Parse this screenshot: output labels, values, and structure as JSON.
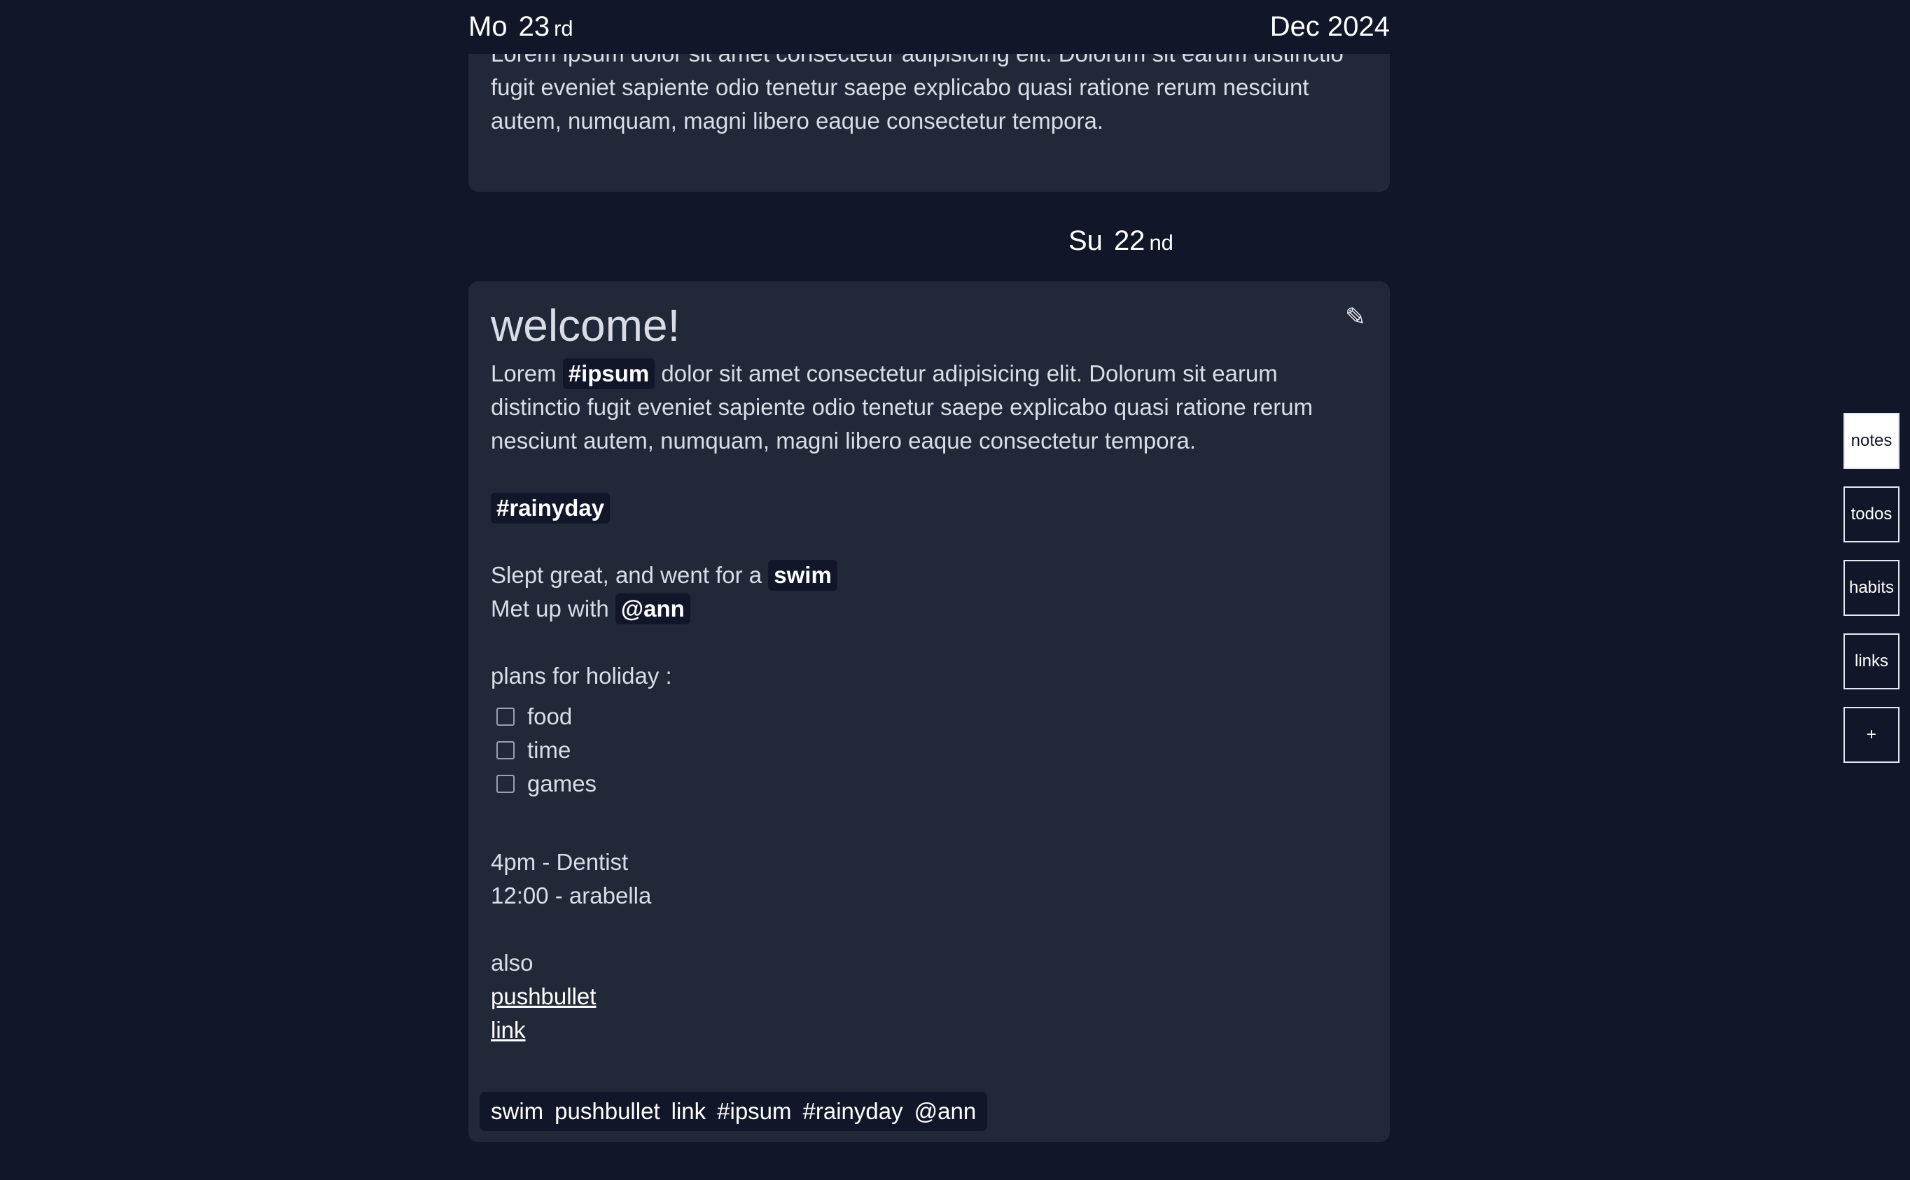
{
  "header": {
    "dow": "Mo",
    "num": "23",
    "suffix": "rd",
    "monthyear": "Dec 2024"
  },
  "prev_card": {
    "text": "Lorem ipsum dolor sit amet consectetur adipisicing elit. Dolorum sit earum distinctio fugit eveniet sapiente odio tenetur saepe explicabo quasi ratione rerum nesciunt autem, numquam, magni libero eaque consectetur tempora."
  },
  "day_label": {
    "dow": "Su",
    "num": "22",
    "suffix": "nd"
  },
  "note": {
    "title": "welcome!",
    "edit_icon": "pencil-icon",
    "p1_before": "Lorem ",
    "p1_tag": "#ipsum",
    "p1_after": " dolor sit amet consectetur adipisicing elit. Dolorum sit earum distinctio fugit eveniet sapiente odio tenetur saepe explicabo quasi ratione rerum nesciunt autem, numquam, magni libero eaque consectetur tempora.",
    "tag_rainyday": "#rainyday",
    "slept_text": "Slept great, and went for a ",
    "swim": "swim",
    "met_text": "Met up with ",
    "ann": "@ann",
    "plans": "plans for holiday :",
    "checklist": [
      "food",
      "time",
      "games"
    ],
    "dentist": "4pm - Dentist",
    "arabella": "12:00 - arabella",
    "also": "also",
    "link1": "pushbullet",
    "link2": "link",
    "chips": [
      "swim",
      "pushbullet",
      "link",
      "#ipsum",
      "#rainyday",
      "@ann"
    ]
  },
  "sidenav": {
    "items": [
      "notes",
      "todos",
      "habits",
      "links",
      "+"
    ],
    "active": "notes"
  },
  "colors": {
    "background": "#111728",
    "card": "#212838",
    "text": "#d9dde6"
  }
}
